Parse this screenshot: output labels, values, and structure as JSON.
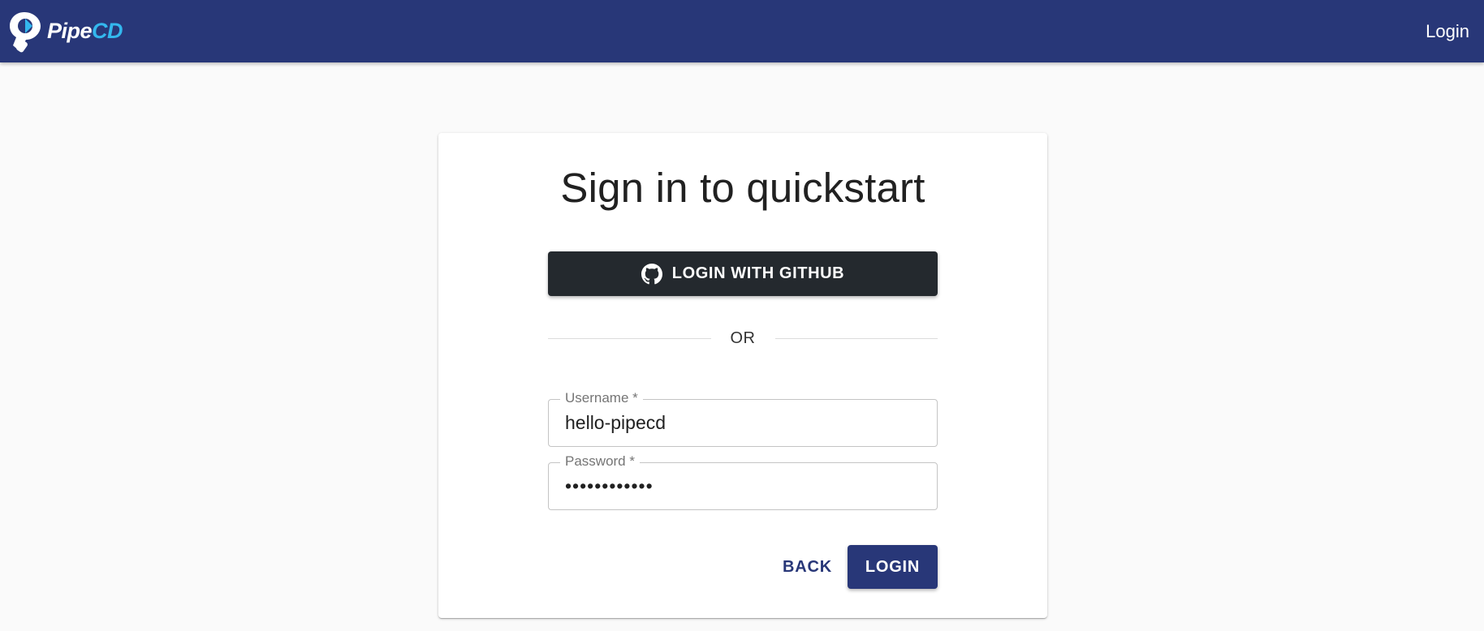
{
  "header": {
    "logo_icon": "pipecd-logo-icon",
    "brand_pipe": "Pipe",
    "brand_cd": "CD",
    "login_label": "Login",
    "background_color": "#283778",
    "brand_accent_color": "#33b7ee"
  },
  "card": {
    "title": "Sign in to quickstart",
    "github_icon": "github-icon",
    "github_button_label": "LOGIN WITH GITHUB",
    "divider_text": "OR",
    "username": {
      "label": "Username *",
      "value": "hello-pipecd"
    },
    "password": {
      "label": "Password *",
      "value": "hellopipecd1"
    },
    "back_button_label": "BACK",
    "login_button_label": "LOGIN",
    "primary_color": "#283778",
    "github_button_color": "#24292e"
  }
}
